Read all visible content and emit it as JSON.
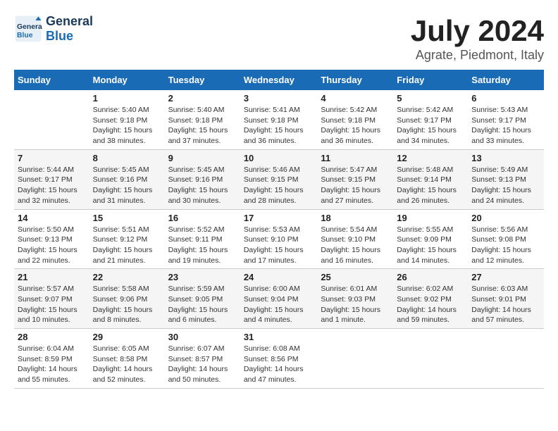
{
  "header": {
    "logo_line1": "General",
    "logo_line2": "Blue",
    "month_year": "July 2024",
    "location": "Agrate, Piedmont, Italy"
  },
  "columns": [
    "Sunday",
    "Monday",
    "Tuesday",
    "Wednesday",
    "Thursday",
    "Friday",
    "Saturday"
  ],
  "weeks": [
    [
      {
        "day": "",
        "sunrise": "",
        "sunset": "",
        "daylight": ""
      },
      {
        "day": "1",
        "sunrise": "Sunrise: 5:40 AM",
        "sunset": "Sunset: 9:18 PM",
        "daylight": "Daylight: 15 hours and 38 minutes."
      },
      {
        "day": "2",
        "sunrise": "Sunrise: 5:40 AM",
        "sunset": "Sunset: 9:18 PM",
        "daylight": "Daylight: 15 hours and 37 minutes."
      },
      {
        "day": "3",
        "sunrise": "Sunrise: 5:41 AM",
        "sunset": "Sunset: 9:18 PM",
        "daylight": "Daylight: 15 hours and 36 minutes."
      },
      {
        "day": "4",
        "sunrise": "Sunrise: 5:42 AM",
        "sunset": "Sunset: 9:18 PM",
        "daylight": "Daylight: 15 hours and 36 minutes."
      },
      {
        "day": "5",
        "sunrise": "Sunrise: 5:42 AM",
        "sunset": "Sunset: 9:17 PM",
        "daylight": "Daylight: 15 hours and 34 minutes."
      },
      {
        "day": "6",
        "sunrise": "Sunrise: 5:43 AM",
        "sunset": "Sunset: 9:17 PM",
        "daylight": "Daylight: 15 hours and 33 minutes."
      }
    ],
    [
      {
        "day": "7",
        "sunrise": "Sunrise: 5:44 AM",
        "sunset": "Sunset: 9:17 PM",
        "daylight": "Daylight: 15 hours and 32 minutes."
      },
      {
        "day": "8",
        "sunrise": "Sunrise: 5:45 AM",
        "sunset": "Sunset: 9:16 PM",
        "daylight": "Daylight: 15 hours and 31 minutes."
      },
      {
        "day": "9",
        "sunrise": "Sunrise: 5:45 AM",
        "sunset": "Sunset: 9:16 PM",
        "daylight": "Daylight: 15 hours and 30 minutes."
      },
      {
        "day": "10",
        "sunrise": "Sunrise: 5:46 AM",
        "sunset": "Sunset: 9:15 PM",
        "daylight": "Daylight: 15 hours and 28 minutes."
      },
      {
        "day": "11",
        "sunrise": "Sunrise: 5:47 AM",
        "sunset": "Sunset: 9:15 PM",
        "daylight": "Daylight: 15 hours and 27 minutes."
      },
      {
        "day": "12",
        "sunrise": "Sunrise: 5:48 AM",
        "sunset": "Sunset: 9:14 PM",
        "daylight": "Daylight: 15 hours and 26 minutes."
      },
      {
        "day": "13",
        "sunrise": "Sunrise: 5:49 AM",
        "sunset": "Sunset: 9:13 PM",
        "daylight": "Daylight: 15 hours and 24 minutes."
      }
    ],
    [
      {
        "day": "14",
        "sunrise": "Sunrise: 5:50 AM",
        "sunset": "Sunset: 9:13 PM",
        "daylight": "Daylight: 15 hours and 22 minutes."
      },
      {
        "day": "15",
        "sunrise": "Sunrise: 5:51 AM",
        "sunset": "Sunset: 9:12 PM",
        "daylight": "Daylight: 15 hours and 21 minutes."
      },
      {
        "day": "16",
        "sunrise": "Sunrise: 5:52 AM",
        "sunset": "Sunset: 9:11 PM",
        "daylight": "Daylight: 15 hours and 19 minutes."
      },
      {
        "day": "17",
        "sunrise": "Sunrise: 5:53 AM",
        "sunset": "Sunset: 9:10 PM",
        "daylight": "Daylight: 15 hours and 17 minutes."
      },
      {
        "day": "18",
        "sunrise": "Sunrise: 5:54 AM",
        "sunset": "Sunset: 9:10 PM",
        "daylight": "Daylight: 15 hours and 16 minutes."
      },
      {
        "day": "19",
        "sunrise": "Sunrise: 5:55 AM",
        "sunset": "Sunset: 9:09 PM",
        "daylight": "Daylight: 15 hours and 14 minutes."
      },
      {
        "day": "20",
        "sunrise": "Sunrise: 5:56 AM",
        "sunset": "Sunset: 9:08 PM",
        "daylight": "Daylight: 15 hours and 12 minutes."
      }
    ],
    [
      {
        "day": "21",
        "sunrise": "Sunrise: 5:57 AM",
        "sunset": "Sunset: 9:07 PM",
        "daylight": "Daylight: 15 hours and 10 minutes."
      },
      {
        "day": "22",
        "sunrise": "Sunrise: 5:58 AM",
        "sunset": "Sunset: 9:06 PM",
        "daylight": "Daylight: 15 hours and 8 minutes."
      },
      {
        "day": "23",
        "sunrise": "Sunrise: 5:59 AM",
        "sunset": "Sunset: 9:05 PM",
        "daylight": "Daylight: 15 hours and 6 minutes."
      },
      {
        "day": "24",
        "sunrise": "Sunrise: 6:00 AM",
        "sunset": "Sunset: 9:04 PM",
        "daylight": "Daylight: 15 hours and 4 minutes."
      },
      {
        "day": "25",
        "sunrise": "Sunrise: 6:01 AM",
        "sunset": "Sunset: 9:03 PM",
        "daylight": "Daylight: 15 hours and 1 minute."
      },
      {
        "day": "26",
        "sunrise": "Sunrise: 6:02 AM",
        "sunset": "Sunset: 9:02 PM",
        "daylight": "Daylight: 14 hours and 59 minutes."
      },
      {
        "day": "27",
        "sunrise": "Sunrise: 6:03 AM",
        "sunset": "Sunset: 9:01 PM",
        "daylight": "Daylight: 14 hours and 57 minutes."
      }
    ],
    [
      {
        "day": "28",
        "sunrise": "Sunrise: 6:04 AM",
        "sunset": "Sunset: 8:59 PM",
        "daylight": "Daylight: 14 hours and 55 minutes."
      },
      {
        "day": "29",
        "sunrise": "Sunrise: 6:05 AM",
        "sunset": "Sunset: 8:58 PM",
        "daylight": "Daylight: 14 hours and 52 minutes."
      },
      {
        "day": "30",
        "sunrise": "Sunrise: 6:07 AM",
        "sunset": "Sunset: 8:57 PM",
        "daylight": "Daylight: 14 hours and 50 minutes."
      },
      {
        "day": "31",
        "sunrise": "Sunrise: 6:08 AM",
        "sunset": "Sunset: 8:56 PM",
        "daylight": "Daylight: 14 hours and 47 minutes."
      },
      {
        "day": "",
        "sunrise": "",
        "sunset": "",
        "daylight": ""
      },
      {
        "day": "",
        "sunrise": "",
        "sunset": "",
        "daylight": ""
      },
      {
        "day": "",
        "sunrise": "",
        "sunset": "",
        "daylight": ""
      }
    ]
  ]
}
